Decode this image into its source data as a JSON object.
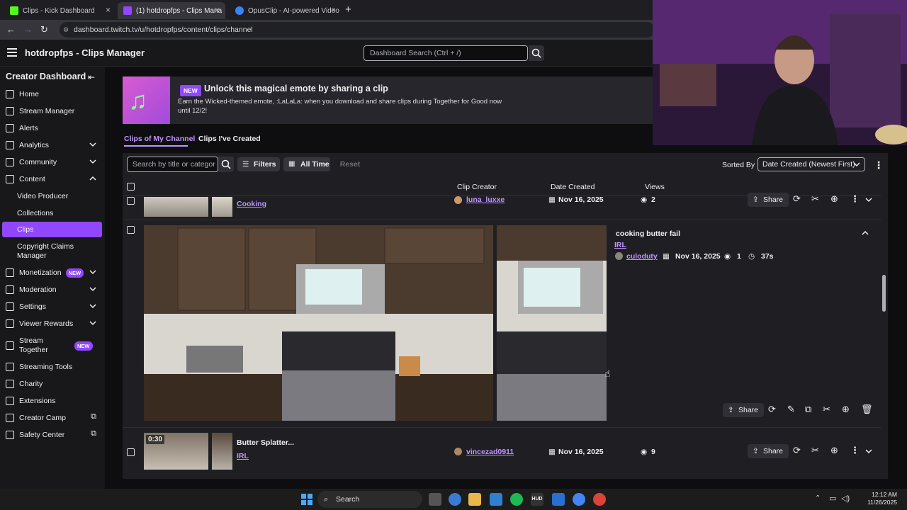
{
  "browser": {
    "tabs": [
      {
        "title": "Clips - Kick Dashboard",
        "favicon_color": "#53fc18"
      },
      {
        "title": "(1) hotdropfps - Clips Mana",
        "favicon_color": "#9147ff"
      },
      {
        "title": "OpusClip - AI-powered Video R",
        "favicon_color": "#3b82f6"
      }
    ],
    "url": "dashboard.twitch.tv/u/hotdropfps/content/clips/channel"
  },
  "header": {
    "title": "hotdropfps - Clips Manager",
    "search_placeholder": "Dashboard Search (Ctrl + /)"
  },
  "sidebar": {
    "title": "Creator Dashboard",
    "items": [
      {
        "label": "Home",
        "icon": "home-icon"
      },
      {
        "label": "Stream Manager",
        "icon": "stream-manager-icon"
      },
      {
        "label": "Alerts",
        "icon": "alerts-icon"
      },
      {
        "label": "Analytics",
        "icon": "analytics-icon",
        "chevron": "down"
      },
      {
        "label": "Community",
        "icon": "community-icon",
        "chevron": "down"
      },
      {
        "label": "Content",
        "icon": "content-icon",
        "chevron": "up"
      },
      {
        "label": "Video Producer",
        "sub": true
      },
      {
        "label": "Collections",
        "sub": true
      },
      {
        "label": "Clips",
        "sub": true,
        "active": true
      },
      {
        "label": "Copyright Claims Manager",
        "sub": true
      },
      {
        "label": "Monetization",
        "icon": "monetization-icon",
        "chevron": "down",
        "badge": "NEW"
      },
      {
        "label": "Moderation",
        "icon": "moderation-icon",
        "chevron": "down"
      },
      {
        "label": "Settings",
        "icon": "settings-icon",
        "chevron": "down"
      },
      {
        "label": "Viewer Rewards",
        "icon": "viewer-rewards-icon",
        "chevron": "down"
      },
      {
        "label": "Stream Together",
        "icon": "stream-together-icon",
        "badge": "NEW"
      },
      {
        "label": "Streaming Tools",
        "icon": "streaming-tools-icon"
      },
      {
        "label": "Charity",
        "icon": "charity-icon"
      },
      {
        "label": "Extensions",
        "icon": "extensions-icon"
      },
      {
        "label": "Creator Camp",
        "icon": "creator-camp-icon",
        "external": true
      },
      {
        "label": "Safety Center",
        "icon": "safety-center-icon",
        "external": true
      }
    ]
  },
  "banner": {
    "badge": "NEW",
    "title": "Unlock this magical emote by sharing a clip",
    "description": "Earn the Wicked-themed emote, :LaLaLa: when you download and share clips during Together for Good now until 12/2!"
  },
  "content_tabs": [
    "Clips of My Channel",
    "Clips I've Created"
  ],
  "filters": {
    "search_placeholder": "Search by title or categor",
    "filters_label": "Filters",
    "time_label": "All Time",
    "reset_label": "Reset",
    "sorted_by_label": "Sorted By",
    "sort_value": "Date Created (Newest First)"
  },
  "columns": [
    "Clip Creator",
    "Date Created",
    "Views"
  ],
  "clips": [
    {
      "title": "",
      "category": "Cooking",
      "creator": "luna_luxxe",
      "date": "Nov 16, 2025",
      "views": "2",
      "share_label": "Share"
    },
    {
      "title": "cooking butter fail",
      "category": "IRL",
      "creator": "culoduty",
      "date": "Nov 16, 2025",
      "views": "1",
      "duration": "37s",
      "share_label": "Share"
    },
    {
      "title": "Butter Splatter...",
      "category": "IRL",
      "creator": "vincezad0911",
      "date": "Nov 16, 2025",
      "views": "9",
      "duration_badge": "0:30",
      "share_label": "Share"
    }
  ],
  "taskbar": {
    "search_label": "Search",
    "time": "12:12 AM",
    "date": "11/26/2025"
  },
  "colors": {
    "accent": "#9147ff",
    "link": "#bf94ff",
    "bg": "#0e0e10",
    "panel": "#1f1f23"
  }
}
